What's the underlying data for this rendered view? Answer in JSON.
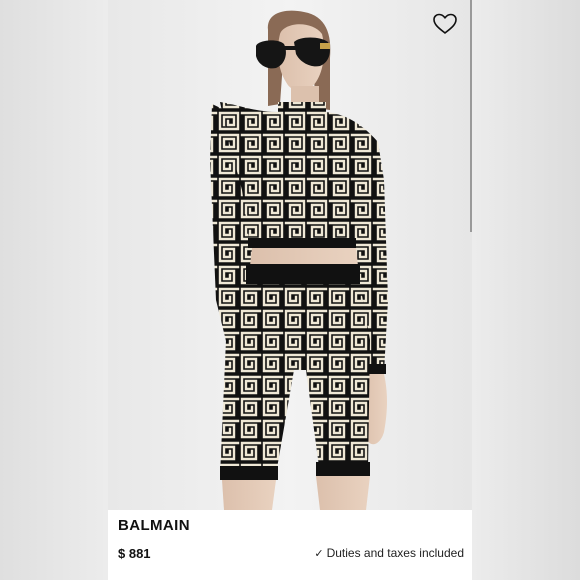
{
  "product": {
    "brand": "BALMAIN",
    "price": "$ 881",
    "duties_text": "Duties and taxes included"
  },
  "icons": {
    "favorite": "heart-icon",
    "check": "checkmark-icon"
  },
  "colors": {
    "card": "#ffffff",
    "text": "#111111",
    "pattern_dark": "#111111",
    "pattern_light": "#efe8d6"
  }
}
